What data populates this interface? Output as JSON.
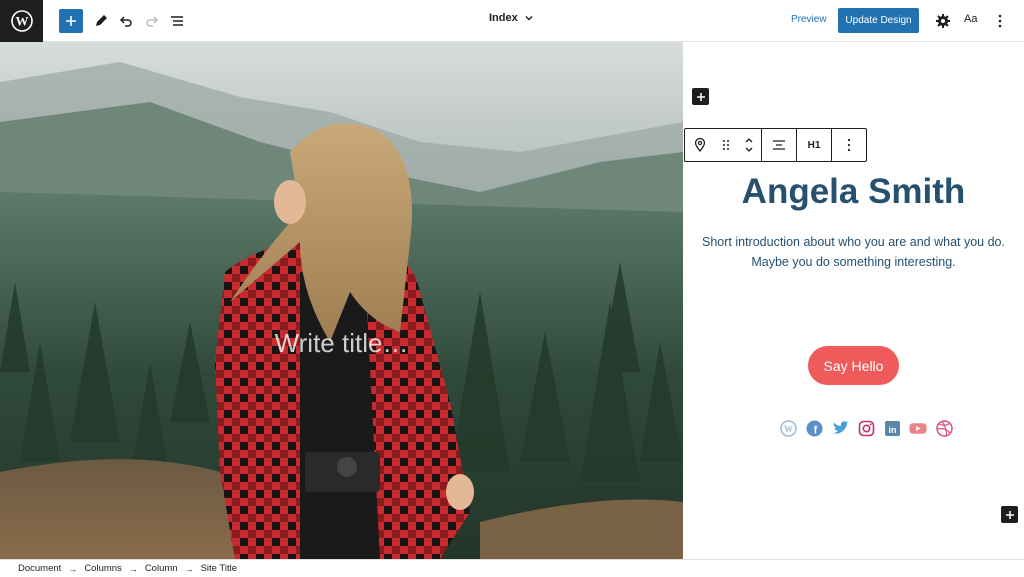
{
  "header": {
    "logo_icon": "wordpress-logo-icon",
    "inserter_icon": "plus-icon",
    "tools_icon": "pencil-icon",
    "undo_icon": "undo-icon",
    "redo_icon": "redo-icon",
    "list_view_icon": "list-view-icon",
    "title": "Index",
    "preview_label": "Preview",
    "update_label": "Update Design",
    "settings_icon": "gear-icon",
    "styles_label": "Aa",
    "options_icon": "more-vertical-icon",
    "accent": "#2271b1"
  },
  "canvas": {
    "cover_title_placeholder": "Write title…",
    "block_toolbar": {
      "heading_level": "H1"
    },
    "profile": {
      "name": "Angela Smith",
      "intro_line1": "Short introduction about who you are and what you do.",
      "intro_line2": "Maybe you do something interesting.",
      "button_label": "Say Hello",
      "text_color": "#25506e",
      "button_color": "#ef5a5a"
    },
    "social_icons": [
      "wordpress-icon",
      "facebook-icon",
      "twitter-icon",
      "instagram-icon",
      "linkedin-icon",
      "youtube-icon",
      "dribbble-icon"
    ]
  },
  "footer": {
    "breadcrumbs": [
      "Document",
      "Columns",
      "Column",
      "Site Title"
    ]
  }
}
